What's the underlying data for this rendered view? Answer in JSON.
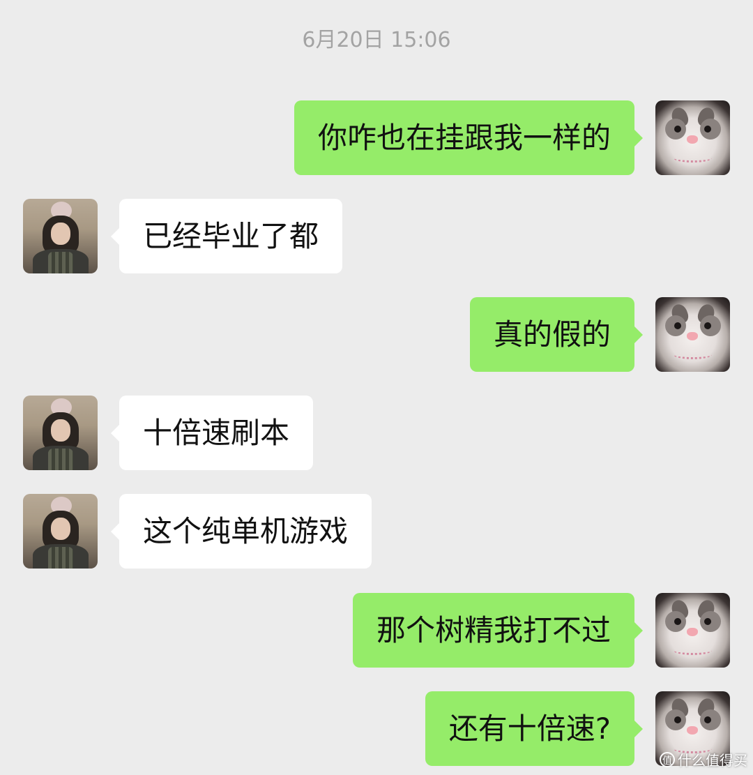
{
  "chat": {
    "timestamp": "6月20日 15:06",
    "colors": {
      "background": "#ececec",
      "outgoing_bubble": "#95ec69",
      "incoming_bubble": "#ffffff"
    },
    "messages": [
      {
        "sender": "self",
        "text": "你咋也在挂跟我一样的"
      },
      {
        "sender": "other",
        "text": "已经毕业了都"
      },
      {
        "sender": "self",
        "text": "真的假的"
      },
      {
        "sender": "other",
        "text": "十倍速刷本"
      },
      {
        "sender": "other",
        "text": "这个纯单机游戏"
      },
      {
        "sender": "self",
        "text": "那个树精我打不过"
      },
      {
        "sender": "self",
        "text": "还有十倍速?"
      }
    ],
    "avatars": {
      "self": "cat-avatar",
      "other": "girl-avatar"
    }
  },
  "watermark": {
    "icon": "value-icon",
    "icon_glyph": "值",
    "text": "什么值得买"
  }
}
